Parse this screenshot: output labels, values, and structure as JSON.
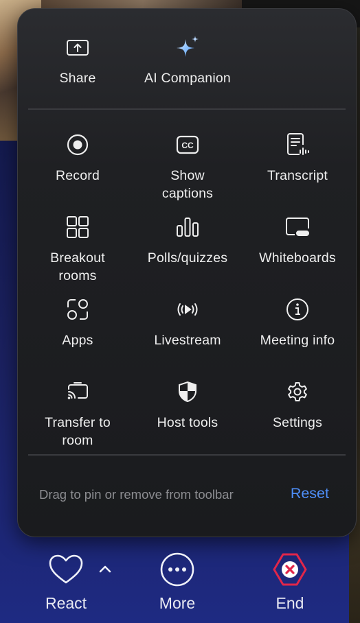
{
  "panel": {
    "top_row": [
      {
        "id": "share",
        "label": "Share",
        "icon": "share-screen-icon"
      },
      {
        "id": "ai",
        "label": "AI Companion",
        "icon": "sparkle-icon"
      }
    ],
    "grid": [
      {
        "id": "record",
        "label": "Record",
        "icon": "record-icon"
      },
      {
        "id": "captions",
        "label": "Show captions",
        "icon": "closed-captions-icon"
      },
      {
        "id": "transcript",
        "label": "Transcript",
        "icon": "transcript-icon"
      },
      {
        "id": "breakout",
        "label": "Breakout rooms",
        "icon": "breakout-rooms-icon"
      },
      {
        "id": "polls",
        "label": "Polls/quizzes",
        "icon": "polls-chart-icon"
      },
      {
        "id": "whiteboards",
        "label": "Whiteboards",
        "icon": "whiteboard-icon"
      },
      {
        "id": "apps",
        "label": "Apps",
        "icon": "apps-icon"
      },
      {
        "id": "livestream",
        "label": "Livestream",
        "icon": "livestream-icon"
      },
      {
        "id": "meeting_info",
        "label": "Meeting info",
        "icon": "info-icon"
      },
      {
        "id": "transfer",
        "label": "Transfer to room",
        "icon": "cast-to-room-icon"
      },
      {
        "id": "host_tools",
        "label": "Host tools",
        "icon": "shield-icon"
      },
      {
        "id": "settings",
        "label": "Settings",
        "icon": "gear-icon"
      }
    ],
    "footer": {
      "hint": "Drag to pin or remove from toolbar",
      "reset_label": "Reset"
    }
  },
  "toolbar": {
    "react": {
      "label": "React",
      "icon": "heart-icon"
    },
    "more": {
      "label": "More",
      "icon": "more-dots-icon"
    },
    "end": {
      "label": "End",
      "icon": "end-meeting-icon"
    }
  },
  "colors": {
    "accent": "#4e8ef7",
    "end_red": "#e0264a",
    "panel_bg": "#1f2023",
    "text": "#eeeeee"
  }
}
